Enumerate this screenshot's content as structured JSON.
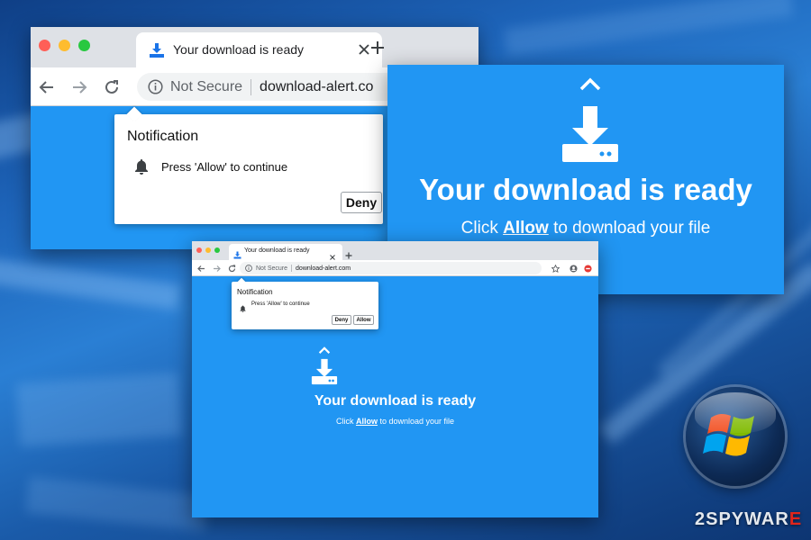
{
  "colors": {
    "page_blue": "#2196f3",
    "chrome_tabstrip": "#dee1e6",
    "mac_close": "#ff5f57",
    "mac_minimize": "#febc2e",
    "mac_zoom": "#28c840",
    "tab_icon": "#1a73e8",
    "brand_red": "#e1251b"
  },
  "icons": {
    "tab_icon": "download-icon",
    "close": "close-icon",
    "new_tab": "plus-icon",
    "back": "arrow-left-icon",
    "forward": "arrow-right-icon",
    "reload": "reload-icon",
    "info": "info-icon",
    "bell": "bell-icon",
    "chevron": "chevron-up-icon",
    "hero": "download-tray-icon",
    "star": "star-icon",
    "profile": "account-icon",
    "extension": "extension-icon",
    "os_logo": "windows-logo"
  },
  "browser": {
    "tab_title": "Your download is ready",
    "security_label": "Not Secure",
    "url_large": "download-alert.co",
    "url_full": "download-alert.com"
  },
  "notification": {
    "title": "Notification",
    "message": "Press 'Allow' to continue",
    "deny_label": "Deny",
    "allow_label": "Allow"
  },
  "page": {
    "headline": "Your download is ready",
    "subtitle_prefix": "Click",
    "subtitle_link": "Allow",
    "subtitle_suffix": "to download your file"
  },
  "watermark": {
    "number": "2",
    "text_main": "SPYWAR",
    "text_accent": "E"
  }
}
